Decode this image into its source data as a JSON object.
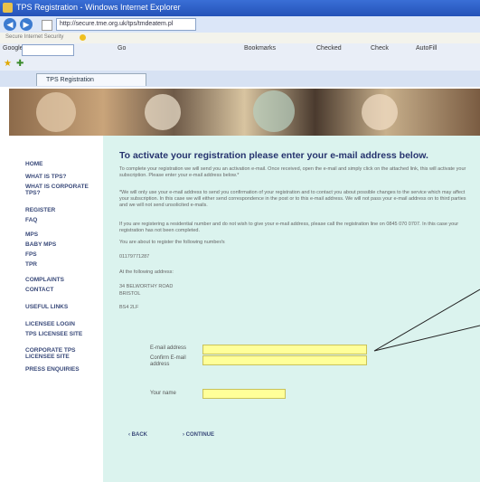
{
  "window": {
    "title": "TPS Registration - Windows Internet Explorer"
  },
  "address_bar": {
    "back": "◀",
    "forward": "▶",
    "url": "http://secure.tme.org.uk/tps/tmdeatem.pl"
  },
  "info_bar": {
    "text": "Secure Internet Security"
  },
  "toolbar": {
    "search_label": "Google",
    "items": [
      "Go",
      "Bookmarks",
      "Checked",
      "Check",
      "AutoFill"
    ]
  },
  "tab": {
    "label": "TPS Registration"
  },
  "sidebar": {
    "items": [
      {
        "label": "HOME"
      },
      {
        "label": "WHAT IS TPS?"
      },
      {
        "label": "WHAT IS CORPORATE TPS?"
      },
      {
        "label": "REGISTER"
      },
      {
        "label": "FAQ"
      },
      {
        "label": "MPS"
      },
      {
        "label": "BABY MPS"
      },
      {
        "label": "FPS"
      },
      {
        "label": "TPR"
      },
      {
        "label": "COMPLAINTS"
      },
      {
        "label": "CONTACT"
      },
      {
        "label": "USEFUL LINKS"
      },
      {
        "label": "LICENSEE LOGIN"
      },
      {
        "label": "TPS LICENSEE SITE"
      },
      {
        "label": "CORPORATE TPS LICENSEE SITE"
      },
      {
        "label": "PRESS ENQUIRIES"
      }
    ]
  },
  "main": {
    "heading": "To activate your registration please enter your e-mail address below.",
    "para1": "To complete your registration we will send you an activation e-mail. Once received, open the e-mail and simply click on the attached link, this will activate your subscription. Please enter your e-mail address below.*",
    "para2": "*We will only use your e-mail address to send you confirmation of your registration and to contact you about possible changes to the service which may affect your subscription. In this case we will either send correspondence in the post or to this e-mail address. We will not pass your e-mail address on to third parties and we will not send unsolicited e-mails.",
    "para3": "If you are registering a residential number and do not wish to give your e-mail address, please call the registration line on 0845 070 0707. In this case your registration has not been completed.",
    "para4": "You are about to register the following number/s",
    "number": "01179771287",
    "para5": "At the following address:",
    "address_line1": "34 BELWORTHY ROAD",
    "address_line2": "BRISTOL",
    "postcode": "BS4 2LF",
    "email_label": "E-mail address",
    "confirm_label": "Confirm E-mail address",
    "name_label": "Your name",
    "email_value": "",
    "confirm_value": "",
    "name_value": "",
    "back_label": "‹ BACK",
    "continue_label": "› CONTINUE"
  },
  "colors": {
    "content_bg": "#dbf3ee",
    "heading": "#26336e",
    "field_bg": "#ffff99",
    "nav_text": "#3a4a7a"
  }
}
